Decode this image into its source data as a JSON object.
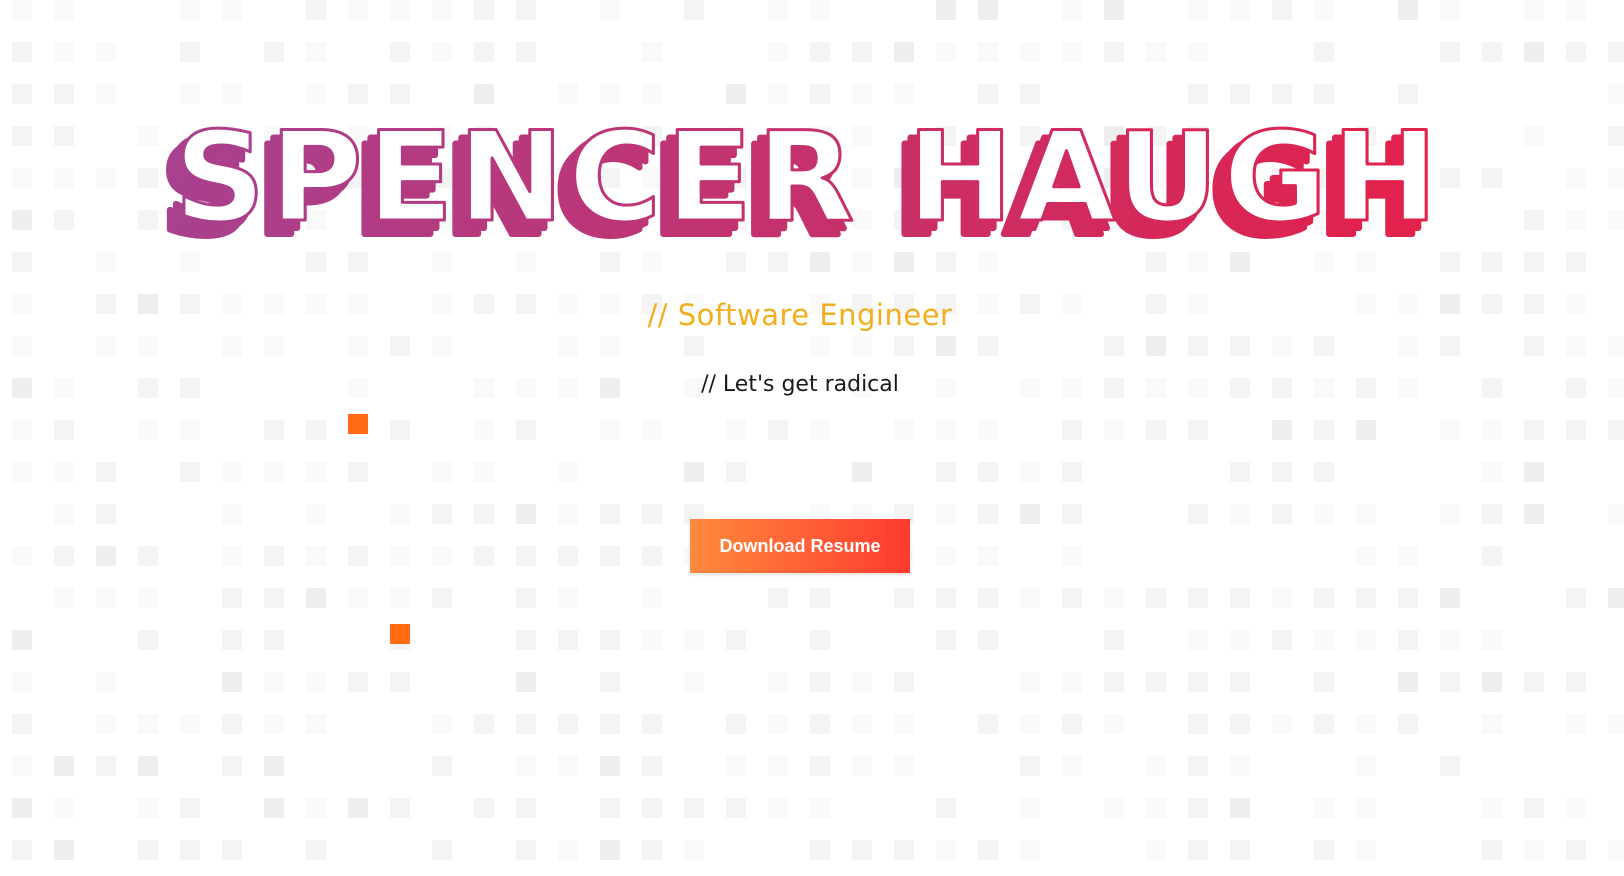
{
  "hero": {
    "name": "SPENCER HAUGH",
    "role": "// Software Engineer",
    "tagline": "// Let's get radical",
    "download_label": "Download Resume"
  },
  "colors": {
    "name_gradient_start": "#a8418f",
    "name_gradient_end": "#e2214a",
    "role": "#f2ae1c",
    "tagline": "#1a1a1a",
    "button_gradient_start": "#ff8a3d",
    "button_gradient_end": "#ff3a2f",
    "highlight_square": "#ff6a13"
  }
}
